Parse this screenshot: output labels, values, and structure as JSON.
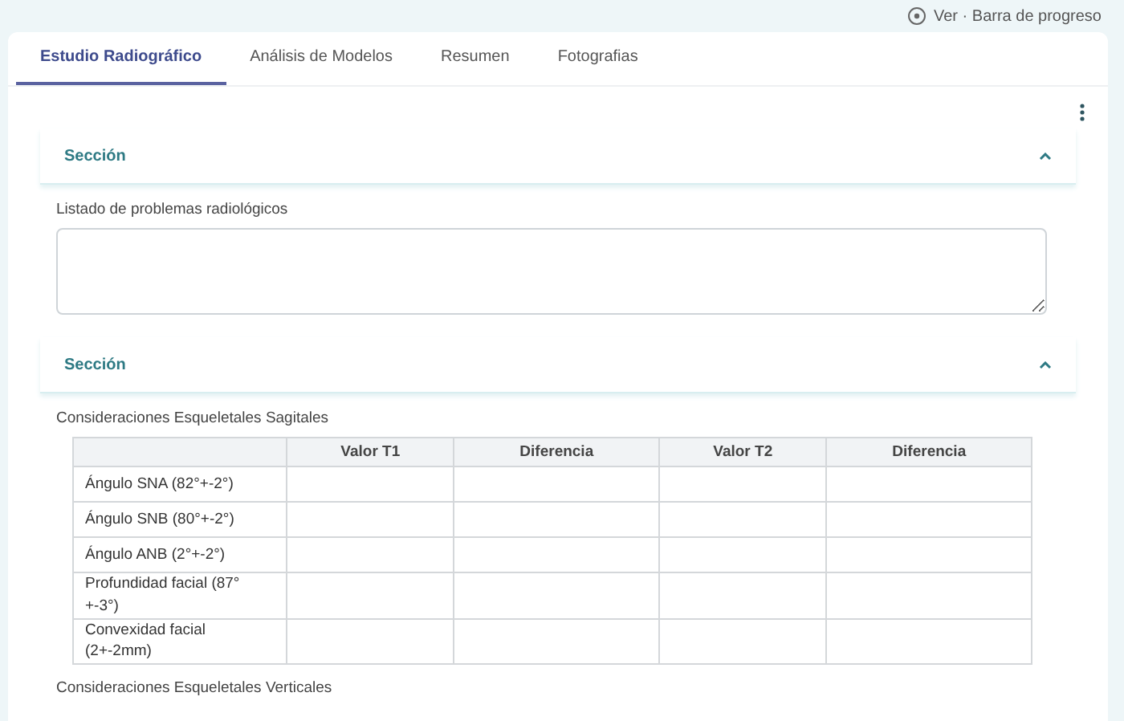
{
  "top_bar": {
    "link": "Ver · Barra de progreso"
  },
  "tabs": [
    {
      "label": "Estudio Radiográfico",
      "selected": true
    },
    {
      "label": "Análisis de Modelos",
      "selected": false
    },
    {
      "label": "Resumen",
      "selected": false
    },
    {
      "label": "Fotografias",
      "selected": false
    }
  ],
  "sections": [
    {
      "title": "Sección",
      "expanded": true,
      "blocks": [
        {
          "kind": "textarea",
          "label": "Listado de problemas radiológicos"
        }
      ]
    },
    {
      "title": "Sección",
      "expanded": true,
      "blocks": [
        {
          "kind": "table",
          "label": "Consideraciones Esqueletales Sagitales",
          "columns": [
            "",
            "Valor T1",
            "Diferencia",
            "Valor T2",
            "Diferencia"
          ],
          "rows": [
            [
              "Ángulo SNA (82°+-2°)",
              "",
              "",
              "",
              ""
            ],
            [
              "Ángulo SNB (80°+-2°)",
              "",
              "",
              "",
              ""
            ],
            [
              "Ángulo ANB (2°+-2°)",
              "",
              "",
              "",
              ""
            ],
            [
              "Profundidad facial (87° +-3°)",
              "",
              "",
              "",
              ""
            ],
            [
              "Convexidad facial (2+-2mm)",
              "",
              "",
              "",
              ""
            ]
          ]
        },
        {
          "kind": "label",
          "label": "Consideraciones Esqueletales Verticales"
        }
      ]
    }
  ]
}
